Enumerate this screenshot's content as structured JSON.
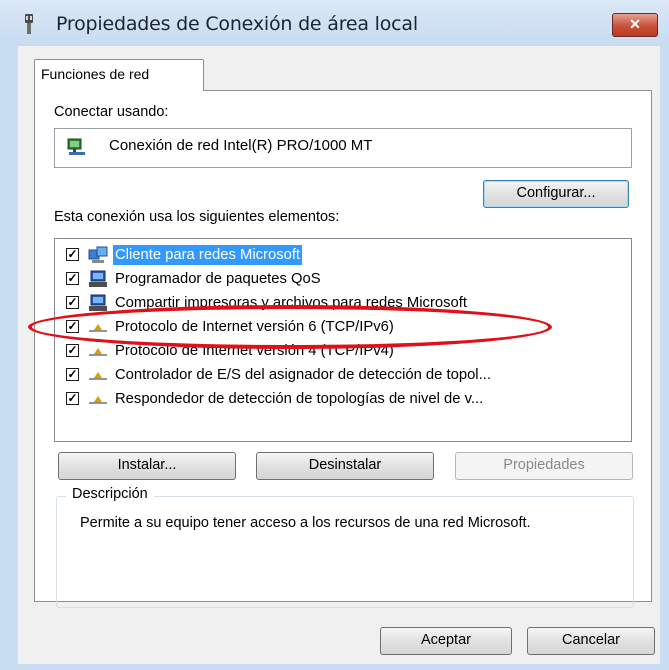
{
  "window": {
    "title": "Propiedades de Conexión de área local",
    "close_label": "✕"
  },
  "tab": {
    "label": "Funciones de red"
  },
  "connect_using": {
    "label": "Conectar usando:",
    "adapter": "Conexión de red Intel(R) PRO/1000 MT",
    "configure_label": "Configurar..."
  },
  "items_label": "Esta conexión usa los siguientes elementos:",
  "items": [
    {
      "label": "Cliente para redes Microsoft",
      "checked": true,
      "icon": "network-client-icon",
      "selected": true
    },
    {
      "label": "Programador de paquetes QoS",
      "checked": true,
      "icon": "service-computer-icon"
    },
    {
      "label": "Compartir impresoras y archivos para redes Microsoft",
      "checked": true,
      "icon": "service-computer-icon"
    },
    {
      "label": "Protocolo de Internet versión 6 (TCP/IPv6)",
      "checked": true,
      "icon": "protocol-icon"
    },
    {
      "label": "Protocolo de Internet versión 4 (TCP/IPv4)",
      "checked": true,
      "icon": "protocol-icon"
    },
    {
      "label": "Controlador de E/S del asignador de detección de topol...",
      "checked": true,
      "icon": "protocol-icon"
    },
    {
      "label": "Respondedor de detección de topologías de nivel de v...",
      "checked": true,
      "icon": "protocol-icon"
    }
  ],
  "buttons": {
    "install": "Instalar...",
    "uninstall": "Desinstalar",
    "properties": "Propiedades"
  },
  "description": {
    "legend": "Descripción",
    "text": "Permite a su equipo tener acceso a los recursos de una red Microsoft."
  },
  "footer": {
    "ok": "Aceptar",
    "cancel": "Cancelar"
  },
  "colors": {
    "selection": "#3399ff",
    "annotation_oval": "#e0101a"
  }
}
